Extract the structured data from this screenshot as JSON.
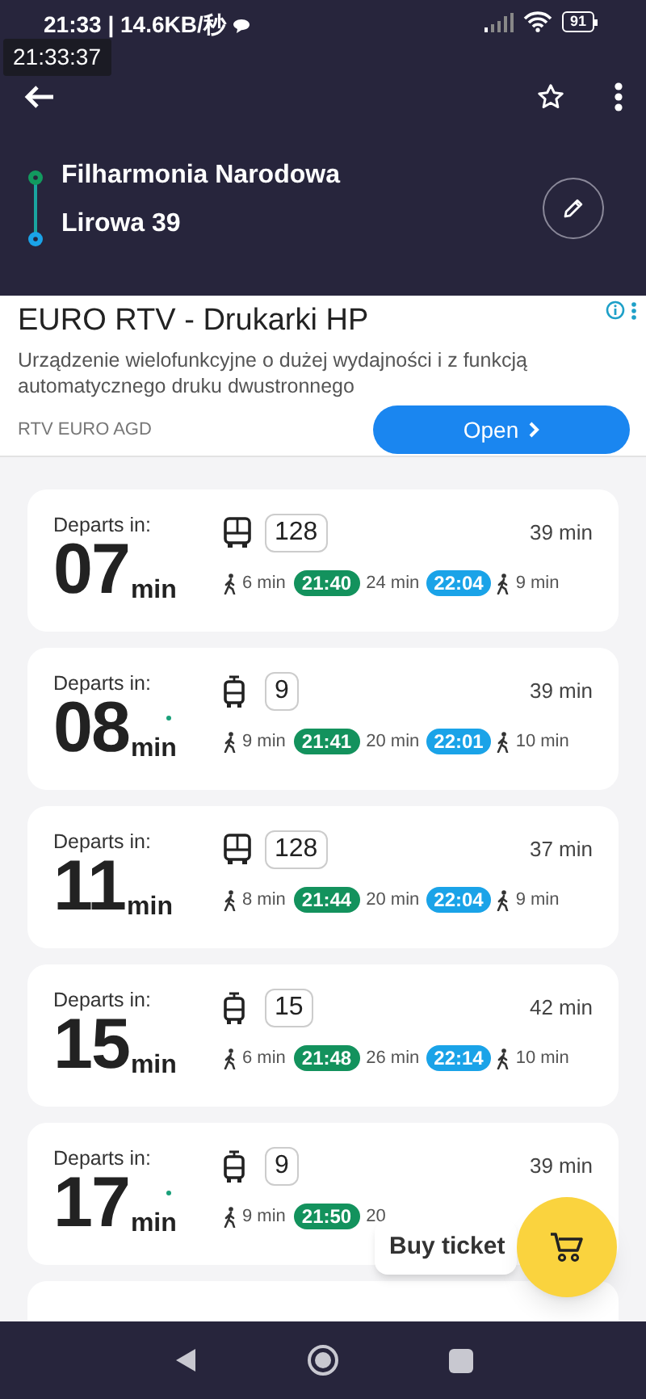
{
  "status_bar": {
    "time": "21:33 | 14.6KB/秒",
    "battery": "91"
  },
  "timestamp_overlay": "21:33:37",
  "route": {
    "from": "Filharmonia Narodowa",
    "to": "Lirowa 39"
  },
  "ad": {
    "title": "EURO RTV - Drukarki HP",
    "text": "Urządzenie wielofunkcyjne o dużej wydajności i z funkcją automatycznego druku dwustronnego",
    "advertiser": "RTV EURO AGD",
    "button": "Open"
  },
  "departures": [
    {
      "label": "Departs in:",
      "minutes": "07",
      "unit": "min",
      "live": false,
      "kind": "bus",
      "line": "128",
      "duration": "39 min",
      "walk_to": "6 min",
      "depart": "21:40",
      "ride": "24 min",
      "arrive": "22:04",
      "walk_from": "9 min"
    },
    {
      "label": "Departs in:",
      "minutes": "08",
      "unit": "min",
      "live": true,
      "kind": "tram",
      "line": "9",
      "duration": "39 min",
      "walk_to": "9 min",
      "depart": "21:41",
      "ride": "20 min",
      "arrive": "22:01",
      "walk_from": "10 min"
    },
    {
      "label": "Departs in:",
      "minutes": "11",
      "unit": "min",
      "live": false,
      "kind": "bus",
      "line": "128",
      "duration": "37 min",
      "walk_to": "8 min",
      "depart": "21:44",
      "ride": "20 min",
      "arrive": "22:04",
      "walk_from": "9 min"
    },
    {
      "label": "Departs in:",
      "minutes": "15",
      "unit": "min",
      "live": false,
      "kind": "tram",
      "line": "15",
      "duration": "42 min",
      "walk_to": "6 min",
      "depart": "21:48",
      "ride": "26 min",
      "arrive": "22:14",
      "walk_from": "10 min"
    },
    {
      "label": "Departs in:",
      "minutes": "17",
      "unit": "min",
      "live": true,
      "kind": "tram",
      "line": "9",
      "duration": "39 min",
      "walk_to": "9 min",
      "depart": "21:50",
      "ride": "20"
    }
  ],
  "buy_ticket": "Buy ticket"
}
